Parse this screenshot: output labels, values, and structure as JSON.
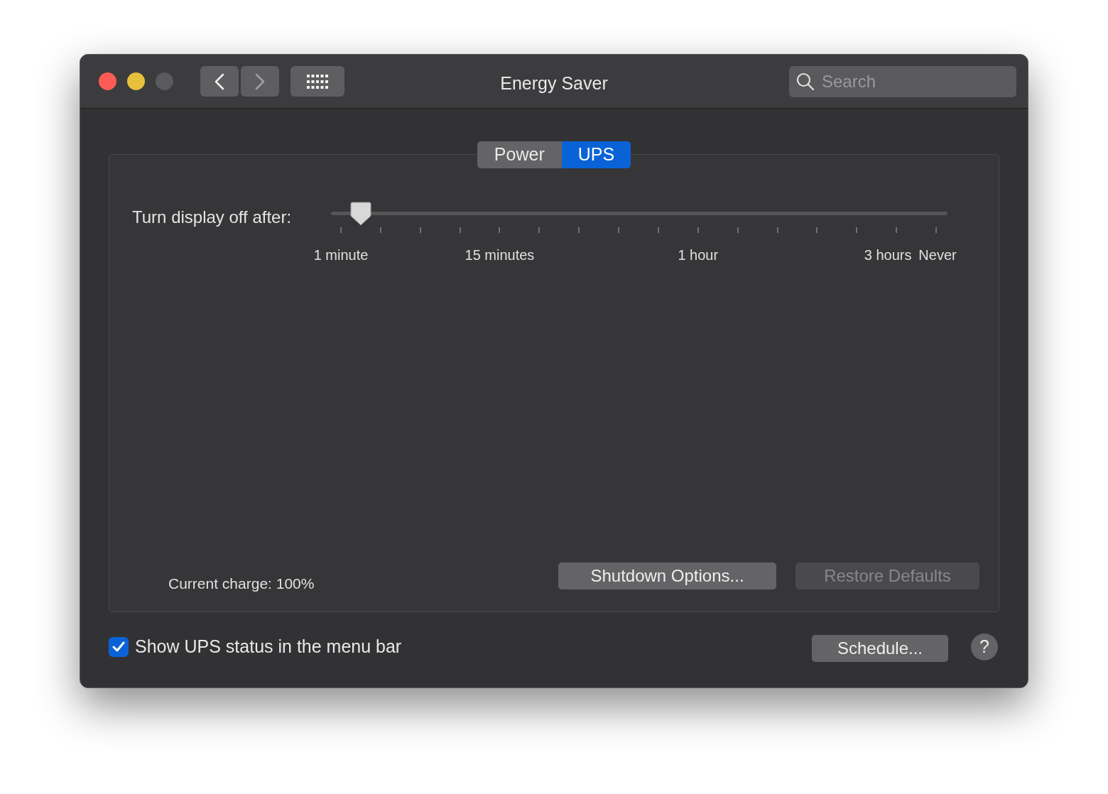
{
  "window": {
    "title": "Energy Saver",
    "zoom_disabled": true,
    "back_enabled": true,
    "forward_enabled": false
  },
  "search": {
    "placeholder": "Search"
  },
  "tabs": [
    {
      "label": "Power",
      "selected": false
    },
    {
      "label": "UPS",
      "selected": true
    }
  ],
  "display_sleep": {
    "label": "Turn display off after:",
    "level": 0.033,
    "tick_labels": [
      "1 minute",
      "15 minutes",
      "1 hour",
      "3 hours",
      "Never"
    ]
  },
  "current_charge": "Current charge: 100%",
  "buttons": [
    {
      "label": "Shutdown Options...",
      "disabled": false
    },
    {
      "label": "Restore Defaults",
      "disabled": true
    }
  ],
  "show_status": {
    "label": "Show UPS status in the menu bar",
    "checked": true
  },
  "schedule_button": "Schedule...",
  "help_button": "?"
}
